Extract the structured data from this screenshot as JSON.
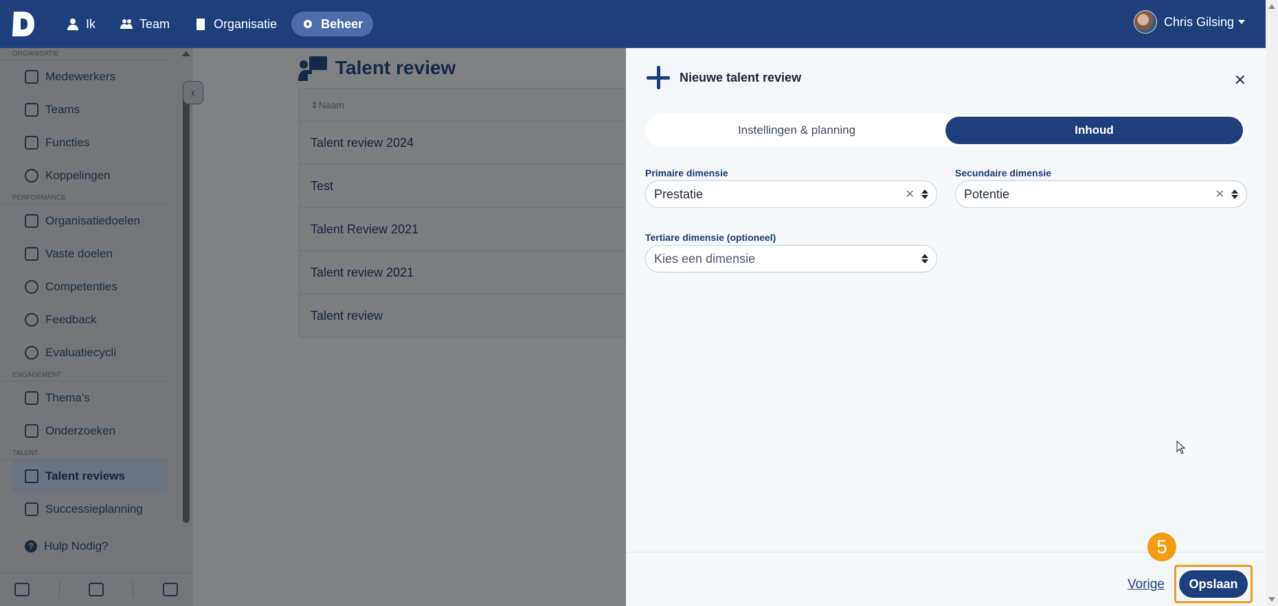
{
  "topbar": {
    "nav": [
      {
        "label": "Ik",
        "icon": "user-icon"
      },
      {
        "label": "Team",
        "icon": "users-icon"
      },
      {
        "label": "Organisatie",
        "icon": "building-icon"
      },
      {
        "label": "Beheer",
        "icon": "gear-icon",
        "active": true
      }
    ],
    "user_name": "Chris Gilsing"
  },
  "sidebar": {
    "sections": [
      {
        "label": "ORGANISATIE",
        "items": [
          "Medewerkers",
          "Teams",
          "Functies",
          "Koppelingen"
        ]
      },
      {
        "label": "PERFORMANCE",
        "items": [
          "Organisatiedoelen",
          "Vaste doelen",
          "Competenties",
          "Feedback",
          "Evaluatiecycli"
        ]
      },
      {
        "label": "ENGAGEMENT",
        "items": [
          "Thema's",
          "Onderzoeken"
        ]
      },
      {
        "label": "TALENT",
        "items": [
          "Talent reviews",
          "Successieplanning"
        ]
      }
    ],
    "active_item": "Talent reviews",
    "help": "Hulp Nodig?"
  },
  "main": {
    "title": "Talent review",
    "table": {
      "column": "Naam",
      "rows": [
        "Talent review 2024",
        "Test",
        "Talent Review 2021",
        "Talent review 2021",
        "Talent review"
      ]
    }
  },
  "modal": {
    "title": "Nieuwe talent review",
    "tabs": [
      {
        "label": "Instellingen & planning",
        "active": false
      },
      {
        "label": "Inhoud",
        "active": true
      }
    ],
    "primary": {
      "label": "Primaire dimensie",
      "value": "Prestatie"
    },
    "secondary": {
      "label": "Secundaire dimensie",
      "value": "Potentie"
    },
    "tertiary": {
      "label": "Tertiare dimensie (optioneel)",
      "placeholder": "Kies een dimensie"
    },
    "footer": {
      "prev": "Vorige",
      "save": "Opslaan"
    },
    "step": "5"
  },
  "colors": {
    "brand": "#1f3f7c",
    "highlight": "#f39c12"
  }
}
